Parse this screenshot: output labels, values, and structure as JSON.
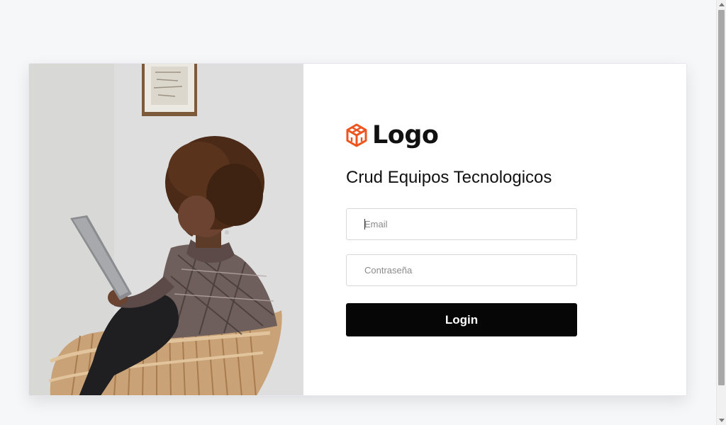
{
  "brand": {
    "logo_text": "Logo",
    "icon": "cube-icon",
    "accent_color": "#f0541e"
  },
  "login": {
    "title": "Crud Equipos Tecnologicos",
    "email_placeholder": "Email",
    "password_placeholder": "Contraseña",
    "submit_label": "Login"
  },
  "photo": {
    "subject": "woman-reading-tablet-photo"
  }
}
